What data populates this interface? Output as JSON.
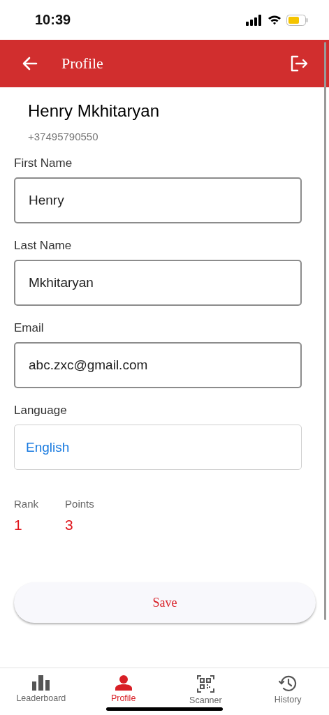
{
  "status_bar": {
    "time": "10:39"
  },
  "app_bar": {
    "title": "Profile"
  },
  "profile": {
    "name": "Henry Mkhitaryan",
    "phone": "+37495790550"
  },
  "fields": [
    {
      "label": "First Name",
      "value": "Henry",
      "kind": "text"
    },
    {
      "label": "Last Name",
      "value": "Mkhitaryan",
      "kind": "text"
    },
    {
      "label": "Email",
      "value": "abc.zxc@gmail.com",
      "kind": "text"
    },
    {
      "label": "Language",
      "value": "English",
      "kind": "select"
    }
  ],
  "stats": [
    {
      "label": "Rank",
      "value": "1"
    },
    {
      "label": "Points",
      "value": "3"
    }
  ],
  "save_button": {
    "label": "Save"
  },
  "tabs": [
    {
      "label": "Leaderboard",
      "kind": "chart",
      "selected": false
    },
    {
      "label": "Profile",
      "kind": "person",
      "selected": true
    },
    {
      "label": "Scanner",
      "kind": "qr",
      "selected": false
    },
    {
      "label": "History",
      "kind": "history",
      "selected": false
    }
  ]
}
